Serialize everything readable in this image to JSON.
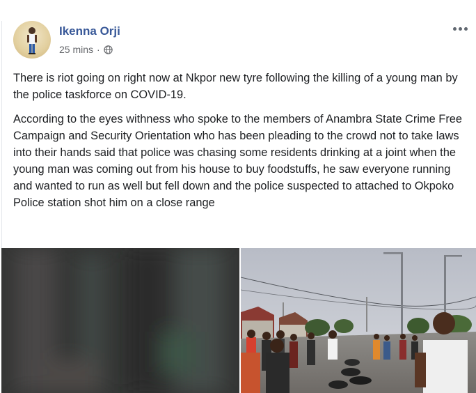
{
  "post": {
    "author": "Ikenna Orji",
    "time": "25 mins",
    "separator": "·",
    "audience_icon": "globe-icon",
    "more_icon": "more-options-icon",
    "paragraph_1": "There is riot going on right now at Nkpor new tyre following the killing of a young man by the police taskforce on COVID-19.",
    "paragraph_2": "According to the eyes withness who spoke to the members of Anambra State Crime Free Campaign and Security Orientation who has been pleading to the crowd not to take laws into their hands said that police was chasing some residents drinking at a joint when the young man was coming out from his house to buy foodstuffs, he saw everyone running and wanted to run as well but fell down and the police suspected to attached to Okpoko Police station shot him on a close range"
  },
  "colors": {
    "author_link": "#385898",
    "body_text": "#1c1e21",
    "meta_text": "#65676b"
  }
}
